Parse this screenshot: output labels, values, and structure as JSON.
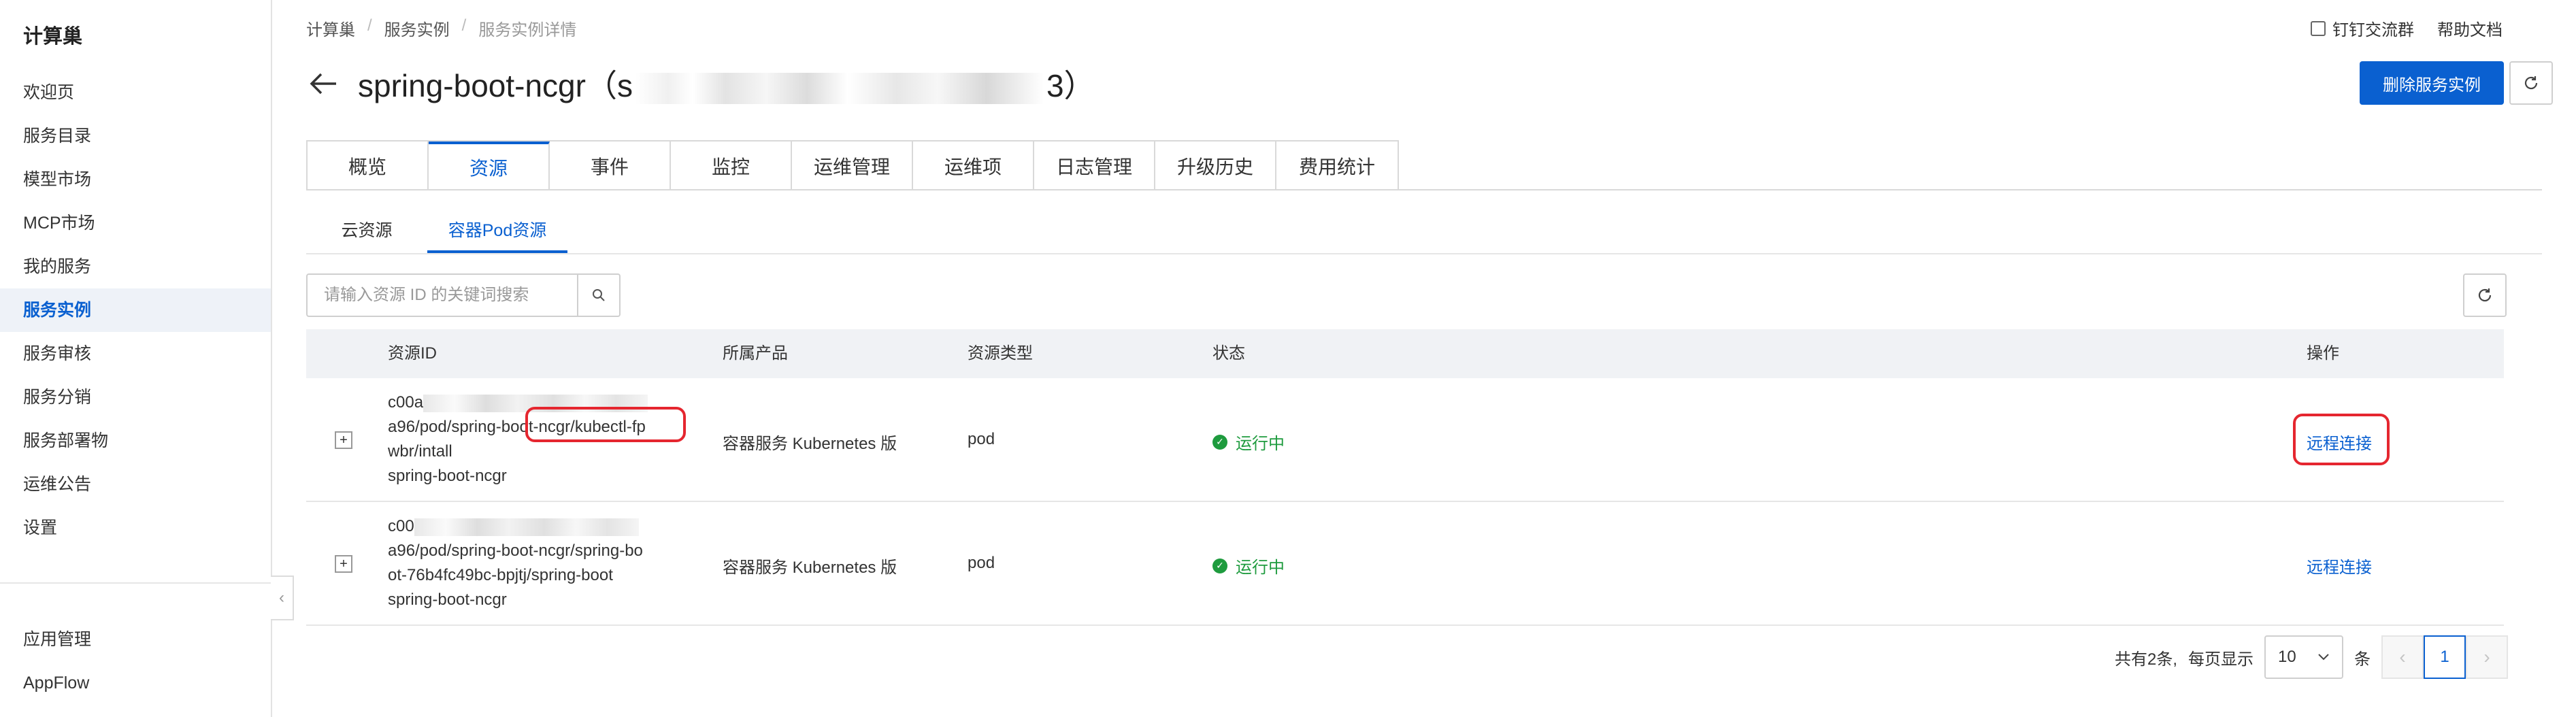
{
  "sidebar": {
    "brand": "计算巢",
    "items": [
      {
        "label": "欢迎页"
      },
      {
        "label": "服务目录"
      },
      {
        "label": "模型市场"
      },
      {
        "label": "MCP市场"
      },
      {
        "label": "我的服务"
      },
      {
        "label": "服务实例"
      },
      {
        "label": "服务审核"
      },
      {
        "label": "服务分销"
      },
      {
        "label": "服务部署物"
      },
      {
        "label": "运维公告"
      },
      {
        "label": "设置"
      }
    ],
    "active_label": "服务实例",
    "bottom_items": [
      {
        "label": "应用管理"
      },
      {
        "label": "AppFlow"
      }
    ]
  },
  "breadcrumb": [
    "计算巢",
    "服务实例",
    "服务实例详情"
  ],
  "top_links": {
    "dingtalk": "钉钉交流群",
    "help": "帮助文档"
  },
  "page": {
    "title_prefix": "spring-boot-ncgr（s",
    "title_suffix": "3）"
  },
  "buttons": {
    "delete": "删除服务实例"
  },
  "tabs": [
    {
      "label": "概览"
    },
    {
      "label": "资源"
    },
    {
      "label": "事件"
    },
    {
      "label": "监控"
    },
    {
      "label": "运维管理"
    },
    {
      "label": "运维项"
    },
    {
      "label": "日志管理"
    },
    {
      "label": "升级历史"
    },
    {
      "label": "费用统计"
    }
  ],
  "active_tab": "资源",
  "subtabs": [
    {
      "label": "云资源"
    },
    {
      "label": "容器Pod资源"
    }
  ],
  "active_subtab": "容器Pod资源",
  "search": {
    "placeholder": "请输入资源 ID 的关键词搜索"
  },
  "table": {
    "columns": {
      "id": "资源ID",
      "product": "所属产品",
      "type": "资源类型",
      "status": "状态",
      "action": "操作"
    },
    "rows": [
      {
        "id_line1": "c00a",
        "id_line2": "a96/pod/spring-boot-ncgr/kubectl-fp",
        "id_line3": "wbr/intall",
        "id_name": "spring-boot-ncgr",
        "product": "容器服务 Kubernetes 版",
        "type": "pod",
        "status": "运行中",
        "action": "远程连接"
      },
      {
        "id_line1": "c00",
        "id_line2": "a96/pod/spring-boot-ncgr/spring-bo",
        "id_line3": "ot-76b4fc49bc-bpjtj/spring-boot",
        "id_name": "spring-boot-ncgr",
        "product": "容器服务 Kubernetes 版",
        "type": "pod",
        "status": "运行中",
        "action": "远程连接"
      }
    ]
  },
  "pagination": {
    "total": "共有2条,",
    "per_page_label": "每页显示",
    "page_size": "10",
    "unit": "条",
    "current": "1"
  },
  "colors": {
    "accent": "#0a60d0",
    "success": "#1e9b3e",
    "highlight": "#e5262f"
  }
}
